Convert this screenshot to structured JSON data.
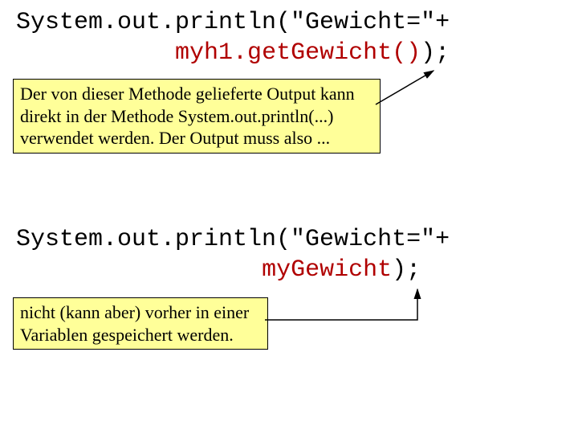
{
  "code1": {
    "line1_black": "System.out.println(\"Gewicht=\"+",
    "line2_indent": "           ",
    "line2_red": "myh1.getGewicht()",
    "line2_black_tail": ");"
  },
  "note1": {
    "l1": "Der von dieser Methode gelieferte Output kann",
    "l2": "direkt in der Methode System.out.println(...)",
    "l3": "verwendet werden. Der Output muss also ..."
  },
  "code2": {
    "line1_black": "System.out.println(\"Gewicht=\"+",
    "line2_indent": "                 ",
    "line2_red": "myGewicht",
    "line2_black_tail": ");"
  },
  "note2": {
    "l1": "nicht (kann aber) vorher in einer",
    "l2": "Variablen gespeichert werden."
  }
}
